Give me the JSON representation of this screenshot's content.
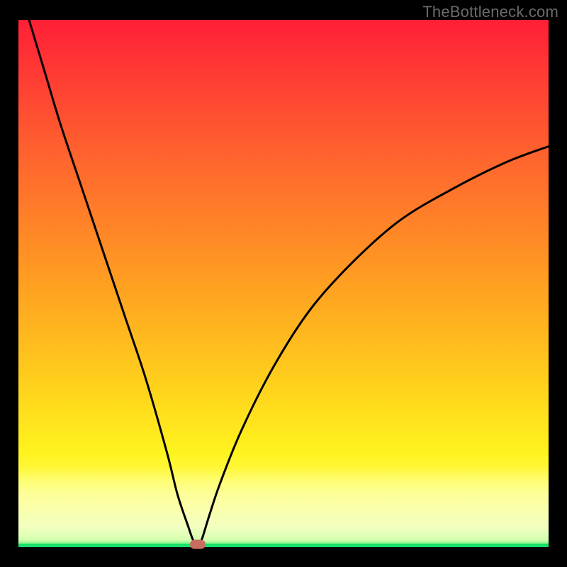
{
  "watermark": "TheBottleneck.com",
  "chart_data": {
    "type": "line",
    "title": "",
    "xlabel": "",
    "ylabel": "",
    "xlim": [
      0,
      100
    ],
    "ylim": [
      0,
      100
    ],
    "grid": false,
    "legend": false,
    "series": [
      {
        "name": "bottleneck-curve",
        "x": [
          2,
          5,
          8,
          12,
          16,
          20,
          24,
          28,
          30,
          32,
          33,
          33.8,
          34.5,
          36,
          38,
          42,
          48,
          55,
          63,
          72,
          82,
          92,
          100
        ],
        "y": [
          100,
          90,
          80,
          68,
          56,
          44,
          32,
          18,
          10,
          4,
          1.2,
          0.3,
          1.2,
          6,
          12,
          22,
          34,
          45,
          54,
          62,
          68,
          73,
          76
        ]
      }
    ],
    "annotations": [
      {
        "name": "optimal-marker",
        "x": 33.8,
        "y": 0.6,
        "shape": "pill",
        "color": "#c96d63"
      }
    ],
    "background_gradient": {
      "stops": [
        {
          "pos": 0.0,
          "color": "#ff1f36"
        },
        {
          "pos": 0.35,
          "color": "#ff7a2a"
        },
        {
          "pos": 0.72,
          "color": "#ffd81c"
        },
        {
          "pos": 0.9,
          "color": "#feff9a"
        },
        {
          "pos": 0.985,
          "color": "#8af58d"
        },
        {
          "pos": 1.0,
          "color": "#17e06a"
        }
      ]
    }
  }
}
